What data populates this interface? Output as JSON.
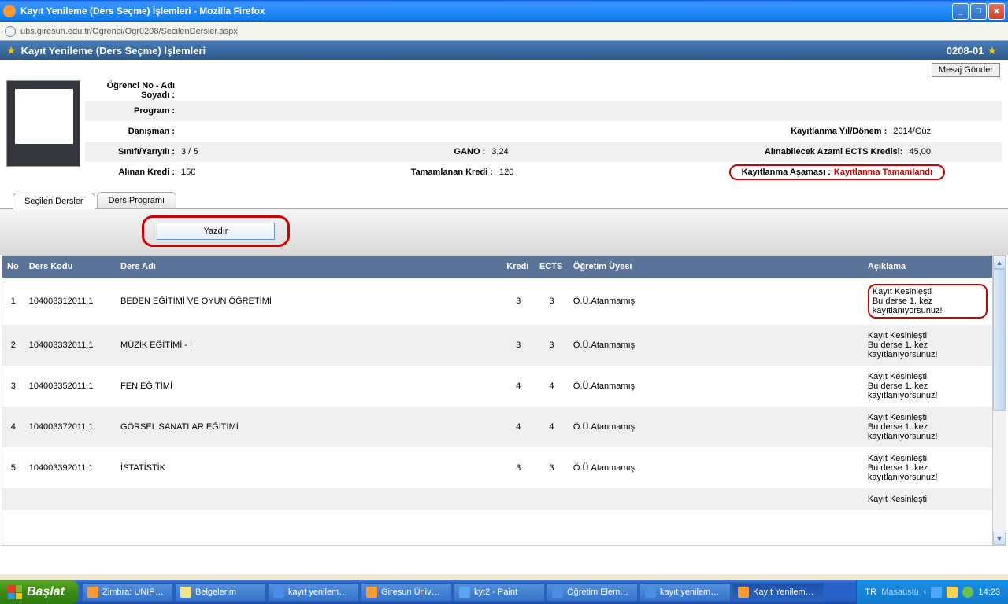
{
  "window": {
    "title": "Kayıt Yenileme (Ders Seçme) İşlemleri - Mozilla Firefox",
    "url": "ubs.giresun.edu.tr/Ogrenci/Ogr0208/SecilenDersler.aspx"
  },
  "page": {
    "title": "Kayıt Yenileme (Ders Seçme) İşlemleri",
    "code": "0208-01",
    "msg_button": "Mesaj Gönder"
  },
  "info": {
    "row1_lbl": "Öğrenci No - Adı Soyadı :",
    "row1_val": "",
    "row2_lbl": "Program :",
    "row2_val": "",
    "row3_lbl": "Danışman :",
    "row3_val": "",
    "row3_r_lbl": "Kayıtlanma Yıl/Dönem :",
    "row3_r_val": "2014/Güz",
    "row4_lbl": "Sınıfı/Yarıyılı :",
    "row4_val": "3 / 5",
    "row4_m_lbl": "GANO :",
    "row4_m_val": "3,24",
    "row4_r_lbl": "Alınabilecek Azami ECTS Kredisi:",
    "row4_r_val": "45,00",
    "row5_lbl": "Alınan Kredi :",
    "row5_val": "150",
    "row5_m_lbl": "Tamamlanan Kredi :",
    "row5_m_val": "120",
    "row5_r_lbl": "Kayıtlanma Aşaması :",
    "row5_r_val": "Kayıtlanma Tamamlandı"
  },
  "tabs": {
    "t1": "Seçilen Dersler",
    "t2": "Ders Programı"
  },
  "print_btn": "Yazdır",
  "headers": {
    "no": "No",
    "kod": "Ders Kodu",
    "ad": "Ders Adı",
    "kredi": "Kredi",
    "ects": "ECTS",
    "ogr": "Öğretim Üyesi",
    "acik": "Açıklama"
  },
  "rows": [
    {
      "no": "1",
      "kod": "104003312011.1",
      "ad": "BEDEN EĞİTİMİ VE OYUN ÖĞRETİMİ",
      "kredi": "3",
      "ects": "3",
      "ogr": "Ö.Ü.Atanmamış",
      "acik": "Kayıt Kesinleşti\nBu derse 1. kez kayıtlanıyorsunuz!"
    },
    {
      "no": "2",
      "kod": "104003332011.1",
      "ad": "MÜZİK EĞİTİMİ - I",
      "kredi": "3",
      "ects": "3",
      "ogr": "Ö.Ü.Atanmamış",
      "acik": "Kayıt Kesinleşti\nBu derse 1. kez kayıtlanıyorsunuz!"
    },
    {
      "no": "3",
      "kod": "104003352011.1",
      "ad": "FEN EĞİTİMİ",
      "kredi": "4",
      "ects": "4",
      "ogr": "Ö.Ü.Atanmamış",
      "acik": "Kayıt Kesinleşti\nBu derse 1. kez kayıtlanıyorsunuz!"
    },
    {
      "no": "4",
      "kod": "104003372011.1",
      "ad": "GÖRSEL SANATLAR EĞİTİMİ",
      "kredi": "4",
      "ects": "4",
      "ogr": "Ö.Ü.Atanmamış",
      "acik": "Kayıt Kesinleşti\nBu derse 1. kez kayıtlanıyorsunuz!"
    },
    {
      "no": "5",
      "kod": "104003392011.1",
      "ad": "İSTATİSTİK",
      "kredi": "3",
      "ects": "3",
      "ogr": "Ö.Ü.Atanmamış",
      "acik": "Kayıt Kesinleşti\nBu derse 1. kez kayıtlanıyorsunuz!"
    },
    {
      "no": "",
      "kod": "",
      "ad": "",
      "kredi": "",
      "ects": "",
      "ogr": "",
      "acik": "Kayıt Kesinleşti"
    }
  ],
  "taskbar": {
    "start": "Başlat",
    "items": [
      "Zimbra: UNIP…",
      "Belgelerim",
      "kayıt yenilem…",
      "Giresun Üniv…",
      "kyt2 - Paint",
      "Öğretim Elem…",
      "kayıt yenilem…",
      "Kayıt Yenilem…"
    ],
    "lang": "TR",
    "desktop": "Masaüstü",
    "time": "14:23"
  }
}
